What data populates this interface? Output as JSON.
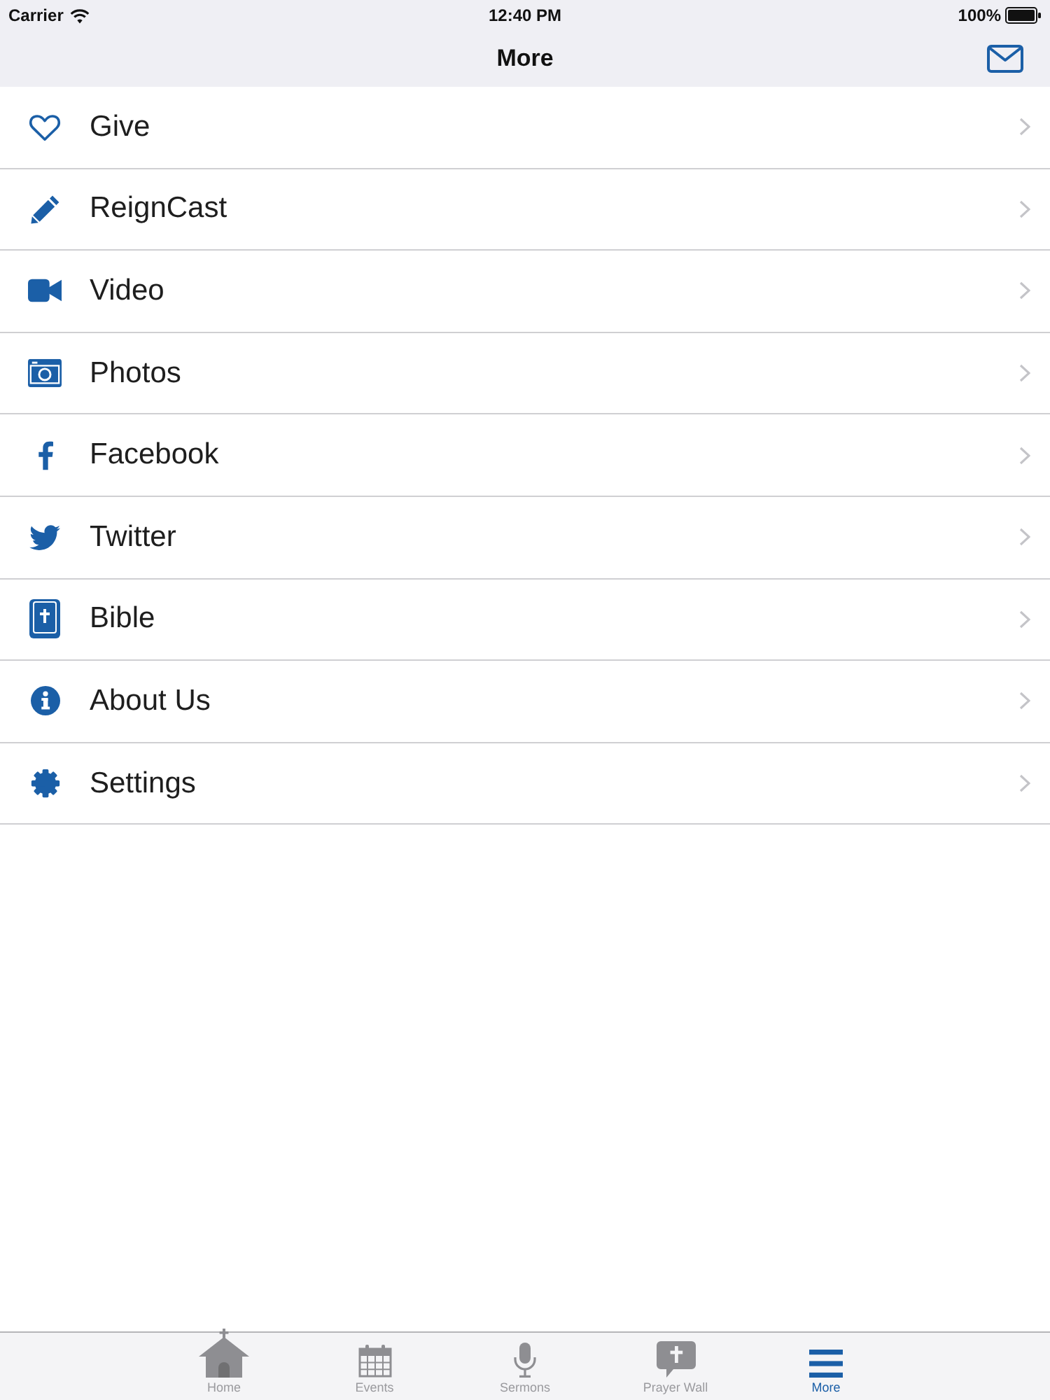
{
  "status_bar": {
    "carrier": "Carrier",
    "time": "12:40 PM",
    "battery": "100%"
  },
  "nav_bar": {
    "title": "More"
  },
  "menu_items": [
    {
      "label": "Give"
    },
    {
      "label": "ReignCast"
    },
    {
      "label": "Video"
    },
    {
      "label": "Photos"
    },
    {
      "label": "Facebook"
    },
    {
      "label": "Twitter"
    },
    {
      "label": "Bible"
    },
    {
      "label": "About Us"
    },
    {
      "label": "Settings"
    }
  ],
  "tab_bar": [
    {
      "label": "Home",
      "selected": false
    },
    {
      "label": "Events",
      "selected": false
    },
    {
      "label": "Sermons",
      "selected": false
    },
    {
      "label": "Prayer Wall",
      "selected": false
    },
    {
      "label": "More",
      "selected": true
    }
  ]
}
